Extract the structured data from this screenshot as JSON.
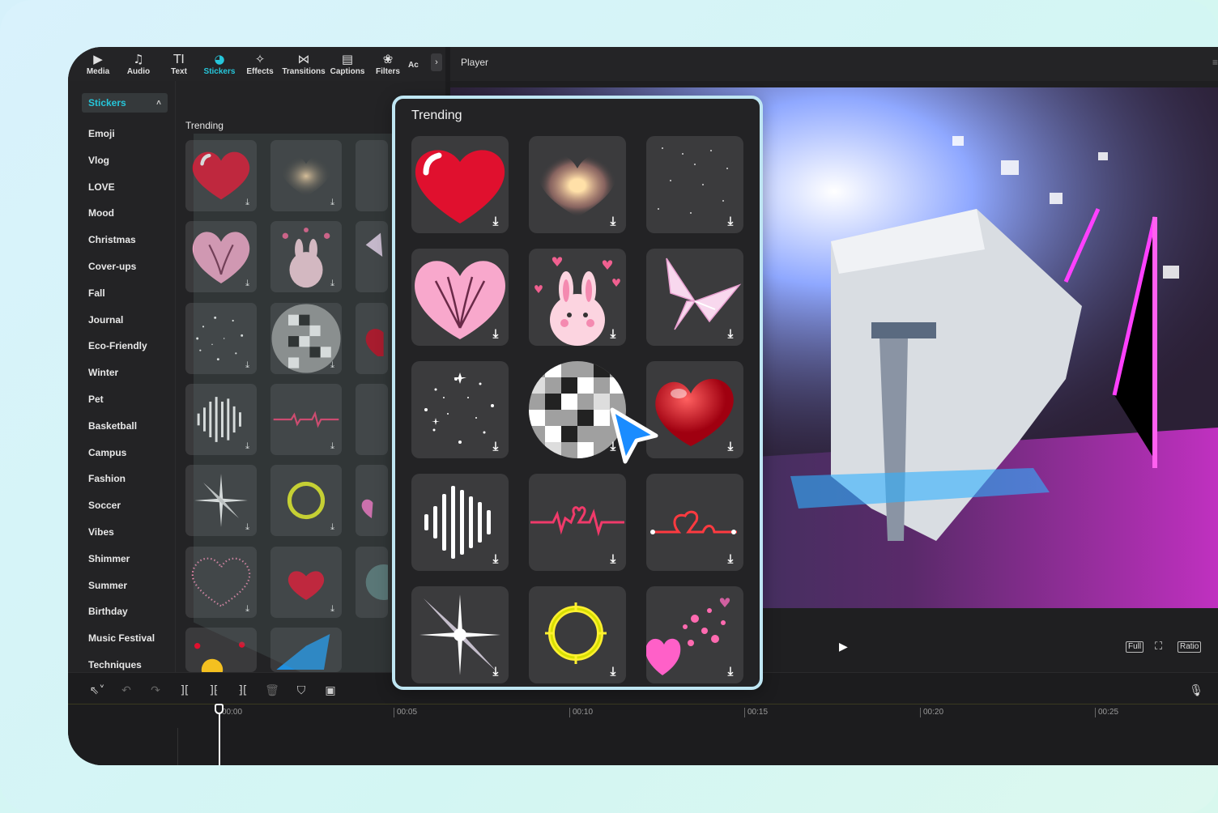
{
  "toolbar": {
    "tools": [
      {
        "label": "Media",
        "icon": "media-icon",
        "glyph": "▶"
      },
      {
        "label": "Audio",
        "icon": "audio-icon",
        "glyph": "♫"
      },
      {
        "label": "Text",
        "icon": "text-icon",
        "glyph": "TI"
      },
      {
        "label": "Stickers",
        "icon": "stickers-icon",
        "glyph": "◕"
      },
      {
        "label": "Effects",
        "icon": "effects-icon",
        "glyph": "✧"
      },
      {
        "label": "Transitions",
        "icon": "transitions-icon",
        "glyph": "⋈"
      },
      {
        "label": "Captions",
        "icon": "captions-icon",
        "glyph": "▤"
      },
      {
        "label": "Filters",
        "icon": "filters-icon",
        "glyph": "❀"
      },
      {
        "label": "Ac",
        "icon": "adjust-icon",
        "glyph": ""
      }
    ],
    "active": "Stickers",
    "more_glyph": "›"
  },
  "category_header": {
    "label": "Stickers",
    "chevron": "˄"
  },
  "categories": [
    "Emoji",
    "Vlog",
    "LOVE",
    "Mood",
    "Christmas",
    "Cover-ups",
    "Fall",
    "Journal",
    "Eco-Friendly",
    "Winter",
    "Pet",
    "Basketball",
    "Campus",
    "Fashion",
    "Soccer",
    "Vibes",
    "Shimmer",
    "Summer",
    "Birthday",
    "Music Festival",
    "Techniques"
  ],
  "grid_title": "Trending",
  "player": {
    "title": "Player",
    "menu_glyph": "≡",
    "full_label": "Full",
    "ratio_label": "Ratio"
  },
  "popup": {
    "title": "Trending"
  },
  "stickers": [
    "red-heart-sticker",
    "glowing-heart-sticker",
    "sparkle-dust-sticker",
    "pink-heart-sticker",
    "pink-bunny-sticker",
    "butterfly-sticker",
    "sparkle-circle-sticker",
    "disco-ball-sticker",
    "red-3d-heart-sticker",
    "sound-wave-sticker",
    "heartbeat-sticker",
    "neon-heart-line-sticker",
    "star-flare-sticker",
    "neon-ring-sticker",
    "floating-hearts-sticker"
  ],
  "timeline": {
    "ticks": [
      "00:00",
      "00:05",
      "00:10",
      "00:15",
      "00:20",
      "00:25"
    ]
  },
  "colors": {
    "accent": "#26c6da",
    "popup_border": "#bfe6f3",
    "cursor": "#1a8cff"
  }
}
